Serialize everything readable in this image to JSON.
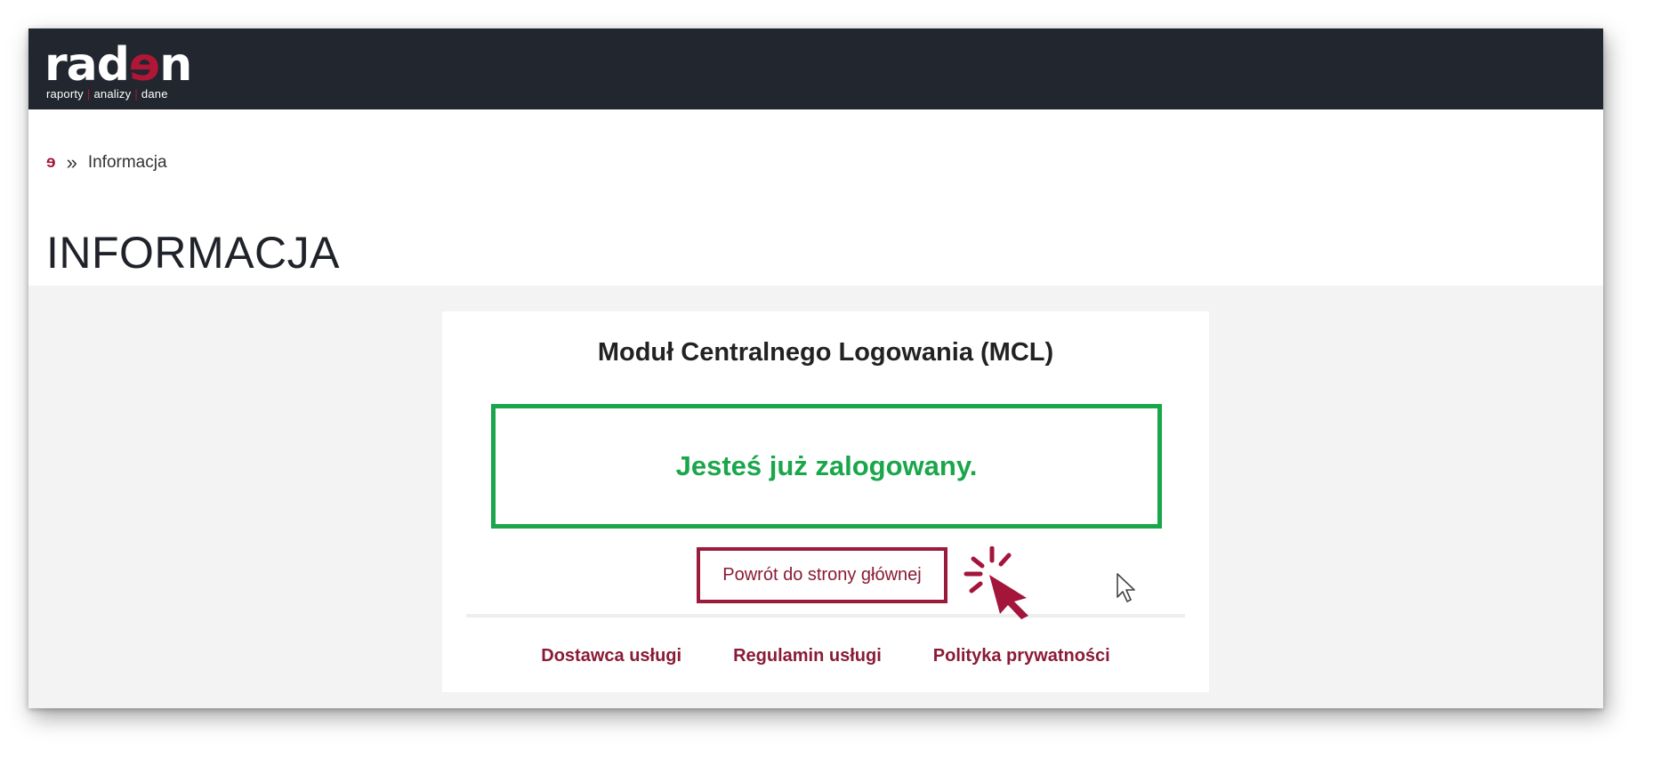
{
  "header": {
    "logo_text_left": "rad",
    "logo_text_e": "ɘ",
    "logo_text_right": "n",
    "logo_tagline": [
      "raporty",
      "analizy",
      "dane"
    ]
  },
  "breadcrumb": {
    "home_icon": "radon-e-icon",
    "home_glyph": "ɘ",
    "separator": "»",
    "current": "Informacja"
  },
  "page": {
    "title": "INFORMACJA"
  },
  "card": {
    "title": "Moduł Centralnego Logowania (MCL)",
    "status_message": "Jesteś już zalogowany.",
    "back_link": "Powrót do strony głównej",
    "footer_links": [
      "Dostawca usługi",
      "Regulamin usługi",
      "Polityka prywatności"
    ]
  },
  "overlay": {
    "click_indicator_icon": "click-hand-pointer-icon",
    "mouse_cursor_icon": "mouse-arrow-cursor-icon"
  },
  "colors": {
    "topbar": "#21262f",
    "brand_accent": "#a3153b",
    "success": "#1aa64a",
    "link": "#8a1b36",
    "background": "#f3f3f3"
  }
}
